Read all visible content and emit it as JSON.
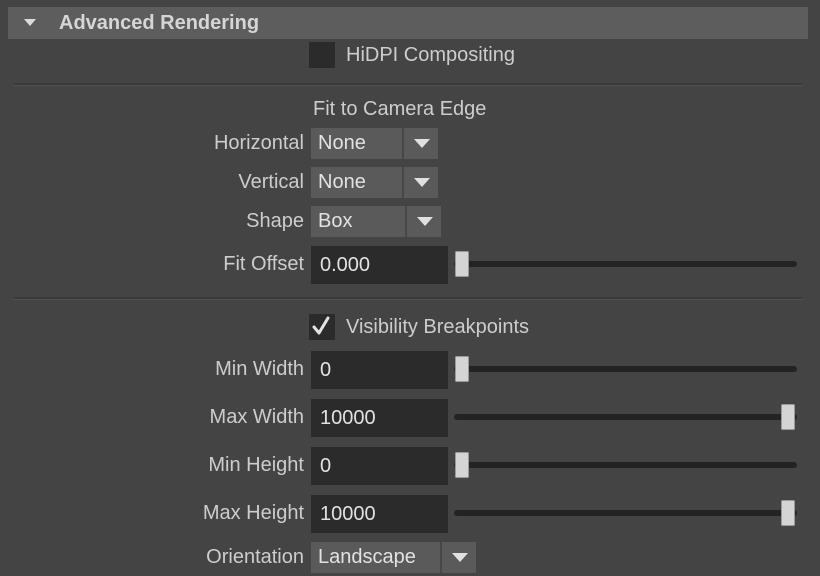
{
  "section": {
    "title": "Advanced Rendering",
    "expanded": true
  },
  "hidpi": {
    "label": "HiDPI Compositing",
    "checked": false
  },
  "fit_group": {
    "title": "Fit to Camera Edge",
    "horizontal": {
      "label": "Horizontal",
      "value": "None"
    },
    "vertical": {
      "label": "Vertical",
      "value": "None"
    },
    "shape": {
      "label": "Shape",
      "value": "Box"
    },
    "fit_offset": {
      "label": "Fit Offset",
      "value": "0.000",
      "slider_fraction": 0.0
    }
  },
  "visibility": {
    "label": "Visibility Breakpoints",
    "checked": true,
    "min_width": {
      "label": "Min Width",
      "value": "0",
      "slider_fraction": 0.0
    },
    "max_width": {
      "label": "Max Width",
      "value": "10000",
      "slider_fraction": 1.0
    },
    "min_height": {
      "label": "Min Height",
      "value": "0",
      "slider_fraction": 0.0
    },
    "max_height": {
      "label": "Max Height",
      "value": "10000",
      "slider_fraction": 1.0
    }
  },
  "orientation": {
    "label": "Orientation",
    "value": "Landscape"
  },
  "icons": {
    "section_toggle": "triangle-down-icon",
    "dropdown_arrow": "chevron-down-icon",
    "checkmark": "checkmark-icon"
  },
  "colors": {
    "background": "#444444",
    "header": "#5d5d5d",
    "field": "#2b2b2b",
    "dropdown": "#5a5a5a",
    "slider_handle": "#d4d4d4"
  }
}
